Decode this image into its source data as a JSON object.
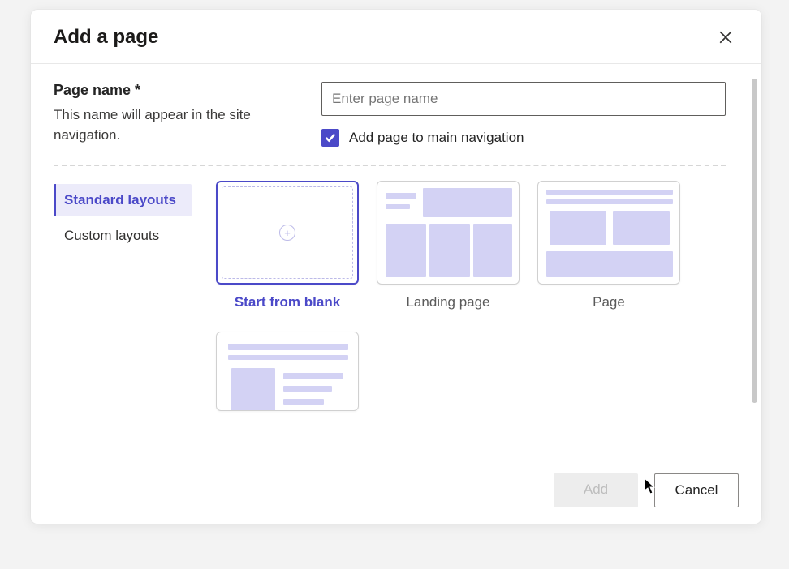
{
  "dialog": {
    "title": "Add a page"
  },
  "form": {
    "page_name_label": "Page name *",
    "page_name_help": "This name will appear in the site navigation.",
    "page_name_placeholder": "Enter page name",
    "page_name_value": "",
    "add_to_nav_checked": true,
    "add_to_nav_label": "Add page to main navigation"
  },
  "layout_tabs": {
    "standard": "Standard layouts",
    "custom": "Custom layouts",
    "active": "standard"
  },
  "layouts": [
    {
      "id": "blank",
      "label": "Start from blank",
      "selected": true
    },
    {
      "id": "landing",
      "label": "Landing page",
      "selected": false
    },
    {
      "id": "page",
      "label": "Page",
      "selected": false
    },
    {
      "id": "article",
      "label": "",
      "selected": false
    }
  ],
  "footer": {
    "add": "Add",
    "cancel": "Cancel"
  },
  "icons": {
    "close": "close-icon",
    "plus": "plus-icon",
    "checkmark": "checkmark-icon"
  },
  "colors": {
    "accent": "#4b49c8",
    "thumb_fill": "#d3d2f4"
  }
}
